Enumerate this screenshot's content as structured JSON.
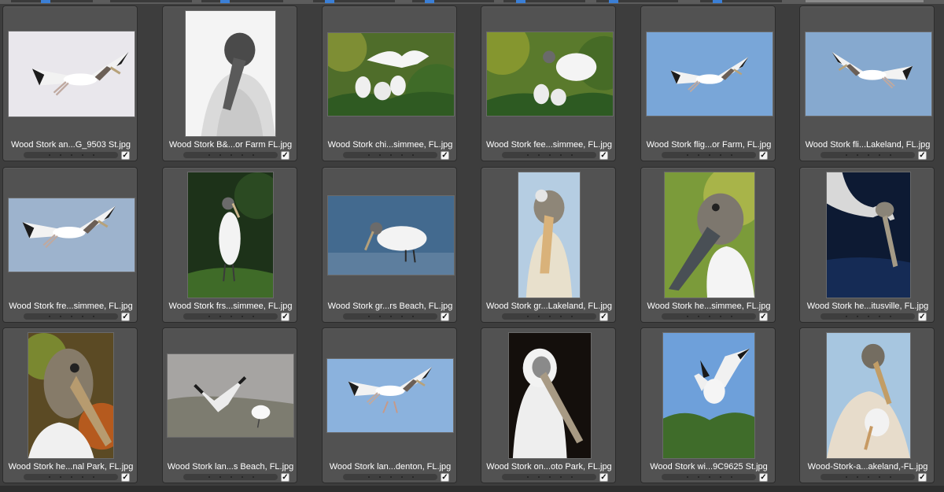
{
  "thumbnails": [
    {
      "filename": "Wood Stork an...G_9503  St.jpg",
      "scene": "flight-white",
      "checked": true
    },
    {
      "filename": "Wood Stork B&...or Farm  FL.jpg",
      "scene": "bw-portrait",
      "checked": true
    },
    {
      "filename": "Wood Stork chi...simmee, FL.jpg",
      "scene": "chicks-nest",
      "checked": true
    },
    {
      "filename": "Wood Stork fee...simmee, FL.jpg",
      "scene": "feeding-nest",
      "checked": true
    },
    {
      "filename": "Wood Stork flig...or Farm, FL.jpg",
      "scene": "flight-blue",
      "checked": true
    },
    {
      "filename": "Wood Stork fli...Lakeland, FL.jpg",
      "scene": "flight-blue-2",
      "checked": true
    },
    {
      "filename": "Wood Stork fre...simmee, FL.jpg",
      "scene": "flight-glide",
      "checked": true
    },
    {
      "filename": "Wood Stork frs...simmee, FL.jpg",
      "scene": "standing-tree",
      "checked": true
    },
    {
      "filename": "Wood Stork gr...rs Beach, FL.jpg",
      "scene": "wading-blue",
      "checked": true
    },
    {
      "filename": "Wood Stork gr...Lakeland, FL.jpg",
      "scene": "juvenile-head",
      "checked": true
    },
    {
      "filename": "Wood Stork he...simmee, FL.jpg",
      "scene": "head-green",
      "checked": true
    },
    {
      "filename": "Wood Stork he...itusville, FL.jpg",
      "scene": "drinking-water",
      "checked": true
    },
    {
      "filename": "Wood Stork he...nal Park, FL.jpg",
      "scene": "head-closeup",
      "checked": true
    },
    {
      "filename": "Wood Stork lan...s Beach, FL.jpg",
      "scene": "landing-beach",
      "checked": true
    },
    {
      "filename": "Wood Stork lan...denton, FL.jpg",
      "scene": "landing-blue",
      "checked": true
    },
    {
      "filename": "Wood Stork on...oto Park, FL.jpg",
      "scene": "portrait-dark",
      "checked": true
    },
    {
      "filename": "Wood Stork wi...9C9625  St.jpg",
      "scene": "wings-tree",
      "checked": true
    },
    {
      "filename": "Wood-Stork-a...akeland,-FL.jpg",
      "scene": "adult-chick",
      "checked": true
    }
  ],
  "colors": {
    "cell_bg": "#525252",
    "app_bg": "#3d3d3d",
    "accent": "#3b7fd6"
  }
}
